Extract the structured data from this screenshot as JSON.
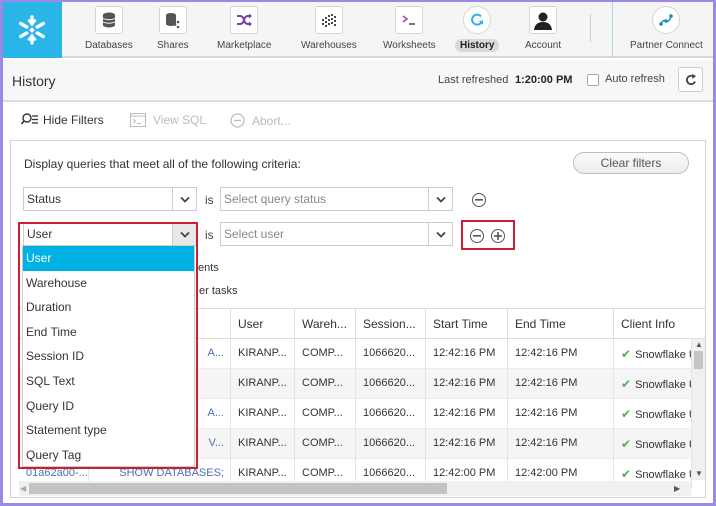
{
  "nav": {
    "items": [
      {
        "label": "Databases",
        "icon": "database-icon"
      },
      {
        "label": "Shares",
        "icon": "shares-icon"
      },
      {
        "label": "Marketplace",
        "icon": "shuffle-icon"
      },
      {
        "label": "Warehouses",
        "icon": "warehouse-icon"
      },
      {
        "label": "Worksheets",
        "icon": "terminal-icon"
      },
      {
        "label": "History",
        "icon": "history-icon",
        "active": true
      },
      {
        "label": "Account",
        "icon": "user-icon"
      },
      {
        "label": "Partner Connect",
        "icon": "partner-connect-icon"
      }
    ],
    "brand_color": "#29b5e8"
  },
  "header": {
    "title": "History",
    "last_refreshed_label": "Last refreshed",
    "last_refreshed_time": "1:20:00 PM",
    "auto_refresh_label": "Auto refresh",
    "auto_refresh_checked": false
  },
  "toolbar": {
    "hide_filters": "Hide Filters",
    "view_sql": "View SQL",
    "abort": "Abort..."
  },
  "filters": {
    "criteria_text": "Display queries that meet all of the following criteria:",
    "clear_label": "Clear filters",
    "is_label": "is",
    "rows": [
      {
        "field": "Status",
        "placeholder": "Select query status"
      },
      {
        "field": "User",
        "placeholder": "Select user"
      }
    ],
    "partial_option_1": "ents",
    "partial_option_2": "er tasks",
    "dropdown_options": [
      "User",
      "Warehouse",
      "Duration",
      "End Time",
      "Session ID",
      "SQL Text",
      "Query ID",
      "Statement type",
      "Query Tag"
    ],
    "dropdown_selected": "User"
  },
  "table": {
    "columns": [
      "User",
      "Wareh...",
      "Session...",
      "Start Time",
      "End Time",
      "Client Info"
    ],
    "rows": [
      {
        "query_id": "",
        "sql_text": "A...",
        "user": "KIRANP...",
        "warehouse": "COMP...",
        "session": "1066620...",
        "start": "12:42:16 PM",
        "end": "12:42:16 PM",
        "client": "Snowflake U"
      },
      {
        "query_id": "",
        "sql_text": "",
        "user": "KIRANP...",
        "warehouse": "COMP...",
        "session": "1066620...",
        "start": "12:42:16 PM",
        "end": "12:42:16 PM",
        "client": "Snowflake U"
      },
      {
        "query_id": "",
        "sql_text": "A...",
        "user": "KIRANP...",
        "warehouse": "COMP...",
        "session": "1066620...",
        "start": "12:42:16 PM",
        "end": "12:42:16 PM",
        "client": "Snowflake U"
      },
      {
        "query_id": "",
        "sql_text": "V...",
        "user": "KIRANP...",
        "warehouse": "COMP...",
        "session": "1066620...",
        "start": "12:42:16 PM",
        "end": "12:42:16 PM",
        "client": "Snowflake U"
      },
      {
        "query_id": "01a62a00-...",
        "sql_text": "SHOW DATABASES;",
        "user": "KIRANP...",
        "warehouse": "COMP...",
        "session": "1066620...",
        "start": "12:42:00 PM",
        "end": "12:42:00 PM",
        "client": "Snowflake U"
      }
    ]
  },
  "colors": {
    "highlight": "#c8202f",
    "selected_option": "#00b2e3",
    "success": "#4caf50",
    "link": "#4a6fb5"
  }
}
